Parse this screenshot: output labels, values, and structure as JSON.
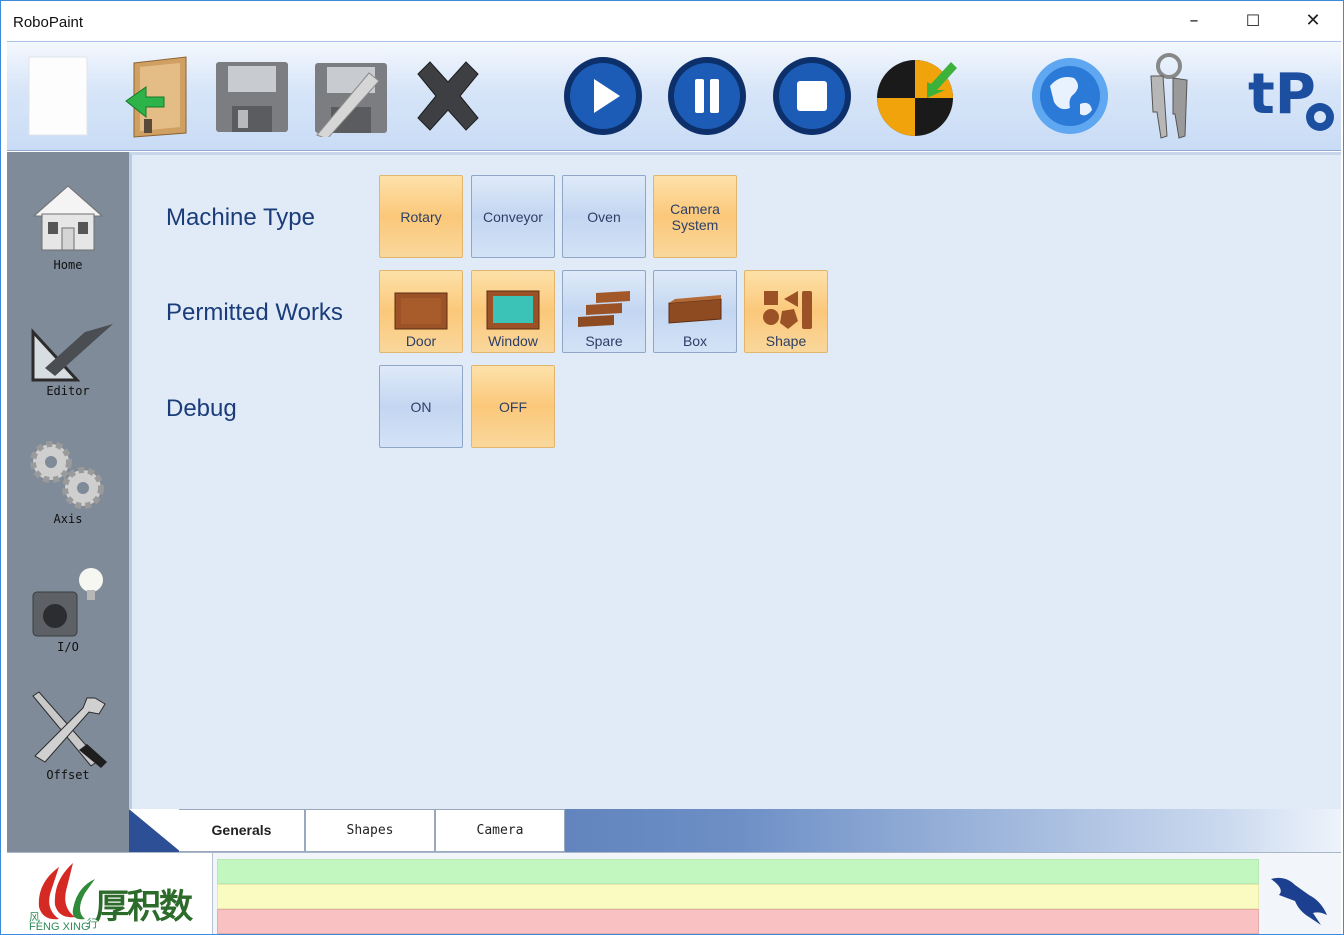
{
  "window": {
    "title": "RoboPaint",
    "minimize_glyph": "–",
    "maximize_glyph": "☐",
    "close_glyph": "✕"
  },
  "toolbar": {
    "buttons": [
      {
        "name": "new",
        "icon": "blank-page-icon"
      },
      {
        "name": "open",
        "icon": "open-folder-icon"
      },
      {
        "name": "save",
        "icon": "floppy-disk-icon"
      },
      {
        "name": "save-as",
        "icon": "floppy-pen-icon"
      },
      {
        "name": "close",
        "icon": "x-icon"
      },
      {
        "name": "play",
        "icon": "play-icon"
      },
      {
        "name": "pause",
        "icon": "pause-icon"
      },
      {
        "name": "stop",
        "icon": "stop-icon"
      },
      {
        "name": "home-origin",
        "icon": "origin-target-icon"
      },
      {
        "name": "language",
        "icon": "globe-icon"
      },
      {
        "name": "login",
        "icon": "keys-icon"
      }
    ],
    "brand_text": "tPa"
  },
  "sidebar": {
    "items": [
      {
        "label": "Home",
        "icon": "house-icon"
      },
      {
        "label": "Editor",
        "icon": "set-square-icon"
      },
      {
        "label": "Axis",
        "icon": "gears-icon"
      },
      {
        "label": "I/O",
        "icon": "lightbulb-io-icon"
      },
      {
        "label": "Offset",
        "icon": "tools-icon"
      }
    ]
  },
  "settings": {
    "machine_type": {
      "label": "Machine Type",
      "options": [
        {
          "label": "Rotary",
          "selected": true
        },
        {
          "label": "Conveyor",
          "selected": false
        },
        {
          "label": "Oven",
          "selected": false
        },
        {
          "label": "Camera System",
          "selected": true
        }
      ]
    },
    "permitted_works": {
      "label": "Permitted Works",
      "options": [
        {
          "label": "Door",
          "selected": true,
          "icon": "door-icon"
        },
        {
          "label": "Window",
          "selected": true,
          "icon": "window-icon"
        },
        {
          "label": "Spare",
          "selected": false,
          "icon": "spare-icon"
        },
        {
          "label": "Box",
          "selected": false,
          "icon": "box-icon"
        },
        {
          "label": "Shape",
          "selected": true,
          "icon": "shapes-icon"
        }
      ]
    },
    "debug": {
      "label": "Debug",
      "options": [
        {
          "label": "ON",
          "selected": false
        },
        {
          "label": "OFF",
          "selected": true
        }
      ]
    }
  },
  "tabs": [
    {
      "label": "Generals",
      "active": true
    },
    {
      "label": "Shapes",
      "active": false
    },
    {
      "label": "Camera",
      "active": false
    }
  ],
  "status": {
    "logo_text": "厚积数控",
    "logo_subtext_left": "风",
    "logo_subtext_right": "行",
    "logo_subtext": "FENG XING",
    "lines": [
      {
        "color": "#c3f7c0",
        "text": ""
      },
      {
        "color": "#fafbc0",
        "text": ""
      },
      {
        "color": "#f9c1c1",
        "text": ""
      }
    ]
  },
  "colors": {
    "accent": "#1a3d7a",
    "selected": "#fbc87a",
    "unselected": "#c3d6f1",
    "sidebar": "#7f8b98"
  }
}
